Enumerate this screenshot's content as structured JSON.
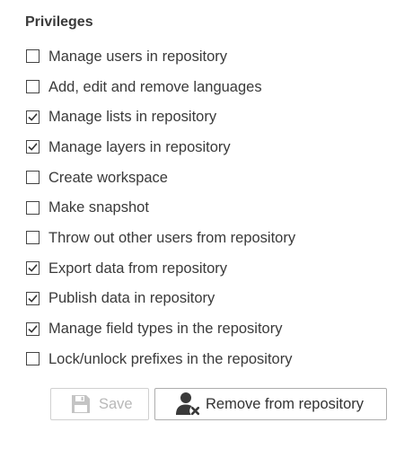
{
  "section": {
    "title": "Privileges"
  },
  "privileges": [
    {
      "label": "Manage users in repository",
      "checked": false
    },
    {
      "label": "Add, edit and remove languages",
      "checked": false
    },
    {
      "label": "Manage lists in repository",
      "checked": true
    },
    {
      "label": "Manage layers in repository",
      "checked": true
    },
    {
      "label": "Create workspace",
      "checked": false
    },
    {
      "label": "Make snapshot",
      "checked": false
    },
    {
      "label": "Throw out other users from repository",
      "checked": false
    },
    {
      "label": "Export data from repository",
      "checked": true
    },
    {
      "label": "Publish data in repository",
      "checked": true
    },
    {
      "label": "Manage field types in the repository",
      "checked": true
    },
    {
      "label": "Lock/unlock prefixes in the repository",
      "checked": false
    }
  ],
  "buttons": {
    "save": {
      "label": "Save",
      "icon": "floppy-disk-icon",
      "enabled": false
    },
    "remove": {
      "label": "Remove from repository",
      "icon": "remove-user-icon",
      "enabled": true
    }
  },
  "colors": {
    "text": "#3a3a3a",
    "disabled_text": "#b8b8b8",
    "border": "#adadad"
  }
}
